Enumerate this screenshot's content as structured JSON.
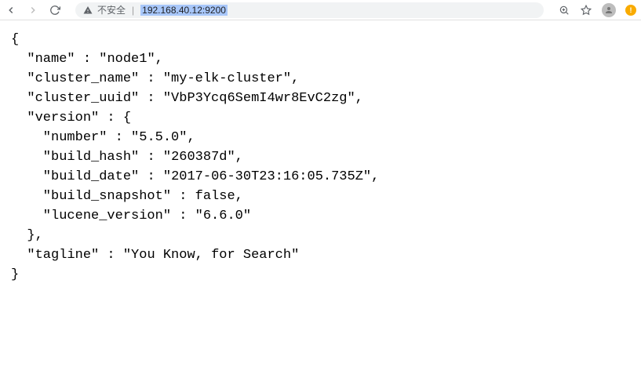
{
  "toolbar": {
    "insecure_label": "不安全",
    "url": "192.168.40.12:9200"
  },
  "response": {
    "name_key": "name",
    "name_val": "node1",
    "cluster_name_key": "cluster_name",
    "cluster_name_val": "my-elk-cluster",
    "cluster_uuid_key": "cluster_uuid",
    "cluster_uuid_val": "VbP3Ycq6SemI4wr8EvC2zg",
    "version_key": "version",
    "number_key": "number",
    "number_val": "5.5.0",
    "build_hash_key": "build_hash",
    "build_hash_val": "260387d",
    "build_date_key": "build_date",
    "build_date_val": "2017-06-30T23:16:05.735Z",
    "build_snapshot_key": "build_snapshot",
    "build_snapshot_val": "false",
    "lucene_version_key": "lucene_version",
    "lucene_version_val": "6.6.0",
    "tagline_key": "tagline",
    "tagline_val": "You Know, for Search"
  }
}
